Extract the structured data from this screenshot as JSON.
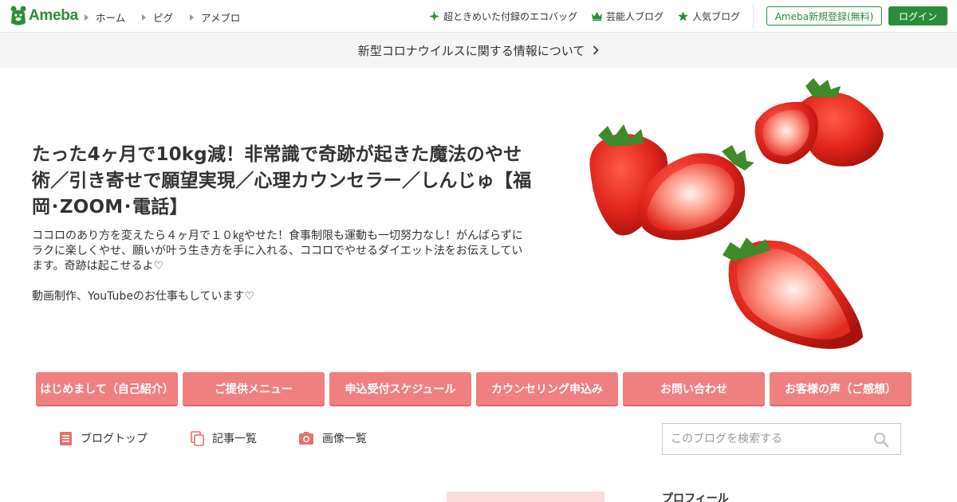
{
  "header": {
    "logo_text": "Ameba",
    "nav": [
      {
        "label": "ホーム"
      },
      {
        "label": "ピグ"
      },
      {
        "label": "アメブロ"
      }
    ],
    "right_links": [
      {
        "label": "超ときめいた付録のエコバッグ",
        "icon": "sparkle-icon"
      },
      {
        "label": "芸能人ブログ",
        "icon": "crown-icon"
      },
      {
        "label": "人気ブログ",
        "icon": "star-icon"
      }
    ],
    "register_label": "Ameba新規登録(無料)",
    "login_label": "ログイン",
    "brand_color": "#2d8c3c"
  },
  "notice": {
    "text": "新型コロナウイルスに関する情報について"
  },
  "blog": {
    "title": "たった4ヶ月で10kg減！非常識で奇跡が起きた魔法のやせ術／引き寄せで願望実現／心理カウンセラー／しんじゅ【福岡･ZOOM･電話】",
    "description": "ココロのあり方を変えたら４ヶ月で１０㎏やせた！食事制限も運動も一切努力なし！がんばらずにラクに楽しくやせ、願いが叶う生き方を手に入れる、ココロでやせるダイエット法をお伝えしています。奇跡は起こせるよ♡\n\n動画制作、YouTubeのお仕事もしています♡",
    "hero_image": "strawberries"
  },
  "menu": {
    "color": "#f08080",
    "items": [
      {
        "label": "はじめまして（自己紹介）"
      },
      {
        "label": "ご提供メニュー"
      },
      {
        "label": "申込受付スケジュール"
      },
      {
        "label": "カウンセリング申込み"
      },
      {
        "label": "お問い合わせ"
      },
      {
        "label": "お客様の声（ご感想）"
      }
    ]
  },
  "blog_nav": {
    "accent": "#e8706a",
    "items": [
      {
        "label": "ブログトップ",
        "icon": "document-icon"
      },
      {
        "label": "記事一覧",
        "icon": "copy-icon"
      },
      {
        "label": "画像一覧",
        "icon": "camera-icon"
      }
    ],
    "search_placeholder": "このブログを検索する"
  },
  "sidebar": {
    "profile_heading": "プロフィール"
  }
}
